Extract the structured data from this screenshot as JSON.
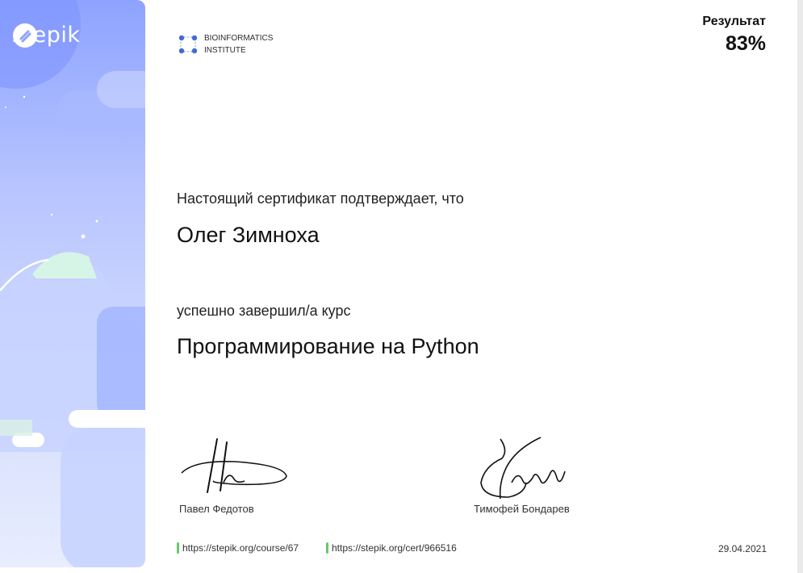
{
  "brand": {
    "logo_text": "stepik",
    "logo_icon": "stepik-logo-icon"
  },
  "institute": {
    "line1": "BIOINFORMATICS",
    "line2": "INSTITUTE",
    "logo_icon": "bioinformatics-logo-icon"
  },
  "result": {
    "label": "Результат",
    "value": "83%"
  },
  "certificate": {
    "intro": "Настоящий сертификат подтверждает, что",
    "recipient": "Олег Зимноха",
    "completed": "успешно завершил/а  курс",
    "course": "Программирование на Python"
  },
  "signatures": [
    {
      "name": "Павел Федотов"
    },
    {
      "name": "Тимофей Бондарев"
    }
  ],
  "links": {
    "course_url": "https://stepik.org/course/67",
    "cert_url": "https://stepik.org/cert/966516"
  },
  "date": "29.04.2021",
  "colors": {
    "accent_green": "#6bc86b",
    "panel_blue": "#8ea3ff"
  }
}
